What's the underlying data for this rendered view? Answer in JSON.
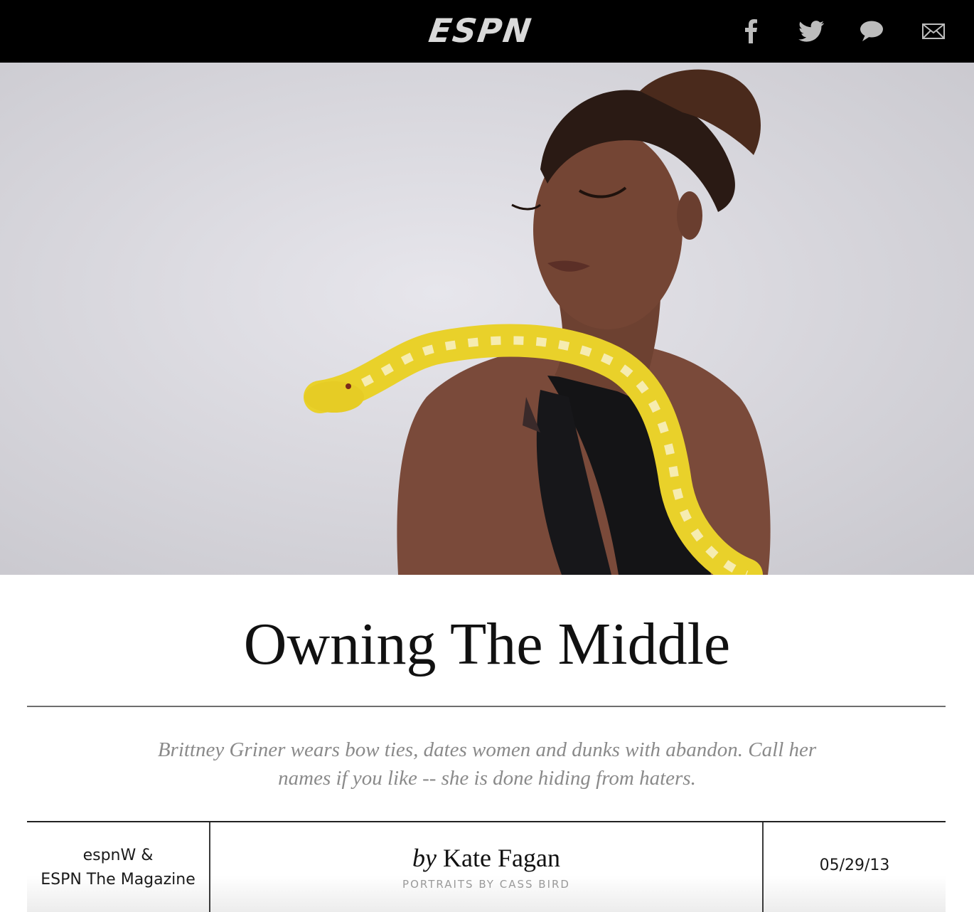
{
  "header": {
    "logo_text": "ESPN",
    "social": [
      {
        "icon": "facebook-icon"
      },
      {
        "icon": "twitter-icon"
      },
      {
        "icon": "comment-icon"
      },
      {
        "icon": "mail-icon"
      }
    ]
  },
  "article": {
    "title": "Owning The Middle",
    "dek": "Brittney Griner wears bow ties, dates women and dunks with abandon. Call her names if you like -- she is done hiding from haters.",
    "publication_line1": "espnW &",
    "publication_line2": "ESPN The Magazine",
    "byline_prefix": "by",
    "author": "Kate Fagan",
    "photo_credit": "PORTRAITS BY CASS BIRD",
    "date": "05/29/13"
  },
  "colors": {
    "topbar": "#000000",
    "logo": "#d9d9d9",
    "dek": "#8a8a8a"
  }
}
